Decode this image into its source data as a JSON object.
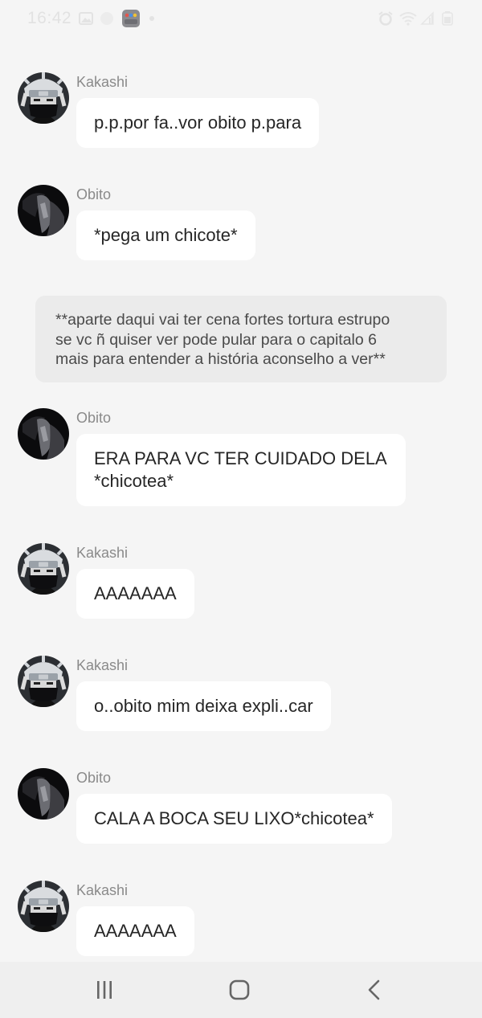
{
  "status_bar": {
    "time": "16:42",
    "left_icons": [
      "gallery-icon",
      "circle-notification-icon",
      "app-notification-icon",
      "dot-icon"
    ],
    "right_icons": [
      "alarm-icon",
      "wifi-icon",
      "signal-icon",
      "battery-icon"
    ]
  },
  "messages": [
    {
      "id": "m1",
      "sender": "Kakashi",
      "avatar": "kakashi-avatar",
      "text": "p.p.por fa..vor obito p.para"
    },
    {
      "id": "m2",
      "sender": "Obito",
      "avatar": "obito-avatar",
      "text": "*pega um chicote*"
    },
    {
      "id": "n1",
      "type": "narration",
      "text": "**aparte daqui vai ter cena fortes tortura estrupo\nse vc ñ quiser ver pode pular para o capitalo 6\nmais para entender a história aconselho a ver**"
    },
    {
      "id": "m3",
      "sender": "Obito",
      "avatar": "obito-avatar",
      "text": "ERA PARA VC TER CUIDADO DELA\n*chicotea*"
    },
    {
      "id": "m4",
      "sender": "Kakashi",
      "avatar": "kakashi-avatar",
      "text": "AAAAAAA"
    },
    {
      "id": "m5",
      "sender": "Kakashi",
      "avatar": "kakashi-avatar",
      "text": "o..obito mim deixa expli..car"
    },
    {
      "id": "m6",
      "sender": "Obito",
      "avatar": "obito-avatar",
      "text": "CALA A BOCA SEU LIXO*chicotea*"
    },
    {
      "id": "m7",
      "sender": "Kakashi",
      "avatar": "kakashi-avatar",
      "text": "AAAAAAA"
    }
  ],
  "nav_bar": {
    "buttons": [
      "recent-apps-icon",
      "home-icon",
      "back-icon"
    ]
  }
}
